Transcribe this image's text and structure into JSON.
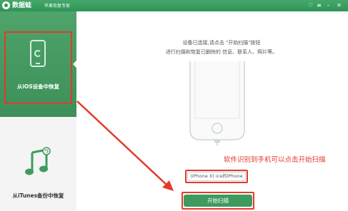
{
  "titlebar": {
    "app_name": "数据蛙",
    "subtitle": "苹果恢复专家",
    "icons": [
      "heart-icon",
      "menu-icon",
      "minimize-icon",
      "close-icon"
    ]
  },
  "sidebar": {
    "items": [
      {
        "label": "从iOS设备中恢复",
        "icon": "phone-recover-icon",
        "active": true
      },
      {
        "label": "从iTunes备份中恢复",
        "icon": "music-note-icon",
        "active": false
      }
    ]
  },
  "main": {
    "instruction_line1": "设备已连接,请点击 \"开始扫描\"按钮",
    "instruction_line2": "进行扫描和恢复已删除的 信息、联系人、照片等。",
    "device_name": "(iPhone X) ice的iPhone",
    "start_label": "开始扫描"
  },
  "annotation": {
    "text": "软件识别到手机可以点击开始扫描",
    "color": "#e23a2a"
  },
  "colors": {
    "accent": "#3f9a5e",
    "titlebar": "#2f9456"
  }
}
